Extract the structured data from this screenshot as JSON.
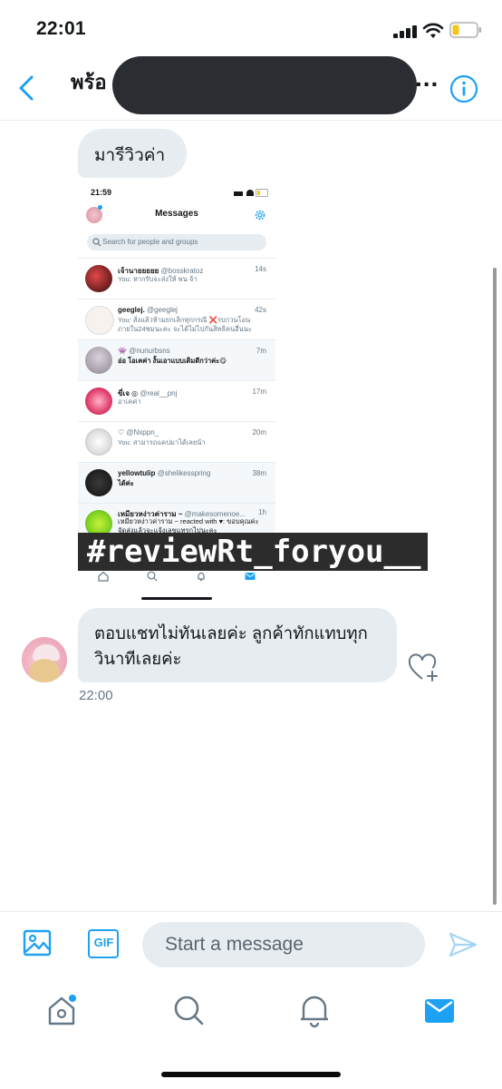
{
  "status_bar": {
    "time": "22:01"
  },
  "header": {
    "title_visible": "พร้อ",
    "ellipsis": "...",
    "icons": [
      "back-chevron-icon",
      "info-icon"
    ]
  },
  "colors": {
    "accent": "#1da1f2",
    "bubble": "#e6ecf0",
    "text": "#14171a",
    "secondary": "#657786",
    "redaction": "#2a2d31"
  },
  "messages": [
    {
      "text": "มารีวิวค่า"
    },
    {
      "attachment": {
        "status_time": "21:59",
        "title": "Messages",
        "search_placeholder": "Search for people and groups",
        "conversations": [
          {
            "name": "เจ้านายยยยย",
            "handle": "@bosskratoz",
            "time": "14s",
            "preview": "You: หากรับจะส่งให้ พน จ้า"
          },
          {
            "name": "geeglej.",
            "handle": "@geeglej",
            "time": "42s",
            "preview": "You: สั่งแล้วห้ามยกเลิกทุกกรณี ❌รบกวนโอนภายใน24ชมนะคะ จะได้ไม่ไปกันสิทธิคนอื่นนะ"
          },
          {
            "name": "👾",
            "handle": "@nunurbsns",
            "time": "7m",
            "preview": "อ่อ โอเคค่า งั้นเอาแบบเดิมดีกว่าค่ะ😋"
          },
          {
            "name": "ขี่เจ ◎",
            "handle": "@real__pnj",
            "time": "17m",
            "preview": "อาเคค่า"
          },
          {
            "name": "♡",
            "handle": "@Nxppn_",
            "time": "20m",
            "preview": "You: สามารถแคปมาได้เลยน้า"
          },
          {
            "name": "yellowtulip",
            "handle": "@shelikesspring",
            "time": "38m",
            "preview": "ได้ค่ะ"
          },
          {
            "name": "เหมียวหง่าวค่าราม ~",
            "handle": "@makesomenoe...",
            "time": "1h",
            "preview": "เหมียวหง่าวค่าราม ~ reacted with ♥: ขอบคุณค่ะ จัดส่งแล้วจะแจ้งเลขแทรกไปนะคะ"
          }
        ],
        "overlay_hashtag": "#reviewRt_foryou__"
      }
    },
    {
      "text": "ตอบแชทไม่ทันเลยค่ะ ลูกค้าทักแทบทุกวินาทีเลยค่ะ",
      "time": "22:00"
    }
  ],
  "composer": {
    "placeholder": "Start a message",
    "gif_label": "GIF"
  },
  "tabbar": {
    "items": [
      "home-icon",
      "search-icon",
      "notifications-icon",
      "messages-icon"
    ],
    "active": "messages-icon"
  }
}
